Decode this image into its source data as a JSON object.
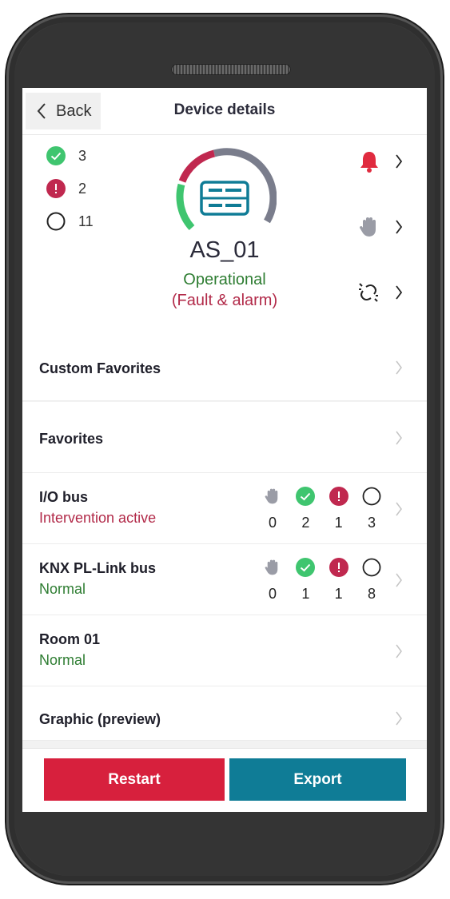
{
  "header": {
    "back_label": "Back",
    "title": "Device details"
  },
  "summary": {
    "counts": [
      {
        "icon": "check-circle-icon",
        "value": "3"
      },
      {
        "icon": "alert-circle-icon",
        "value": "2"
      },
      {
        "icon": "empty-circle-icon",
        "value": "11"
      }
    ],
    "device_name": "AS_01",
    "state": "Operational",
    "substate": "(Fault & alarm)",
    "colors": {
      "ok": "#3fc56f",
      "alarm": "#c0284f",
      "neutral": "#7a7d8c",
      "bell": "#e02b3f"
    },
    "side_actions": [
      "bell-icon",
      "hand-icon",
      "broken-link-icon"
    ]
  },
  "list": {
    "items": [
      {
        "name": "Custom Favorites"
      },
      {
        "name": "Favorites"
      },
      {
        "name": "I/O bus",
        "status": "Intervention active",
        "status_color": "#b22a49",
        "stats": [
          "0",
          "2",
          "1",
          "3"
        ]
      },
      {
        "name": "KNX PL-Link bus",
        "status": "Normal",
        "status_color": "#2e7d32",
        "stats": [
          "0",
          "1",
          "1",
          "8"
        ]
      },
      {
        "name": "Room 01",
        "status": "Normal",
        "status_color": "#2e7d32"
      },
      {
        "name": "Graphic (preview)"
      }
    ]
  },
  "footer": {
    "restart_label": "Restart",
    "export_label": "Export"
  }
}
